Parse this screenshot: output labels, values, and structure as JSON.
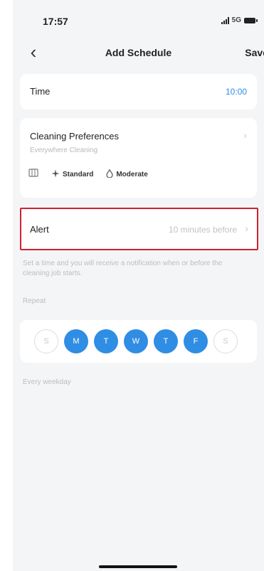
{
  "status_bar": {
    "time": "17:57",
    "network": "5G"
  },
  "nav": {
    "title": "Add Schedule",
    "save_label": "Save"
  },
  "time_row": {
    "label": "Time",
    "value": "10:00",
    "accent": "#2f8de4"
  },
  "preferences": {
    "title": "Cleaning Preferences",
    "subtitle": "Everywhere Cleaning",
    "suction": "Standard",
    "water": "Moderate"
  },
  "alert_row": {
    "label": "Alert",
    "value": "10 minutes before",
    "highlight": "#d0202f"
  },
  "hint": "Set a time and you will receive a notification when or before the cleaning job starts.",
  "repeat": {
    "label": "Repeat",
    "days": [
      {
        "letter": "S",
        "on": false
      },
      {
        "letter": "M",
        "on": true
      },
      {
        "letter": "T",
        "on": true
      },
      {
        "letter": "W",
        "on": true
      },
      {
        "letter": "T",
        "on": true
      },
      {
        "letter": "F",
        "on": true
      },
      {
        "letter": "S",
        "on": false
      }
    ],
    "summary": "Every weekday"
  }
}
